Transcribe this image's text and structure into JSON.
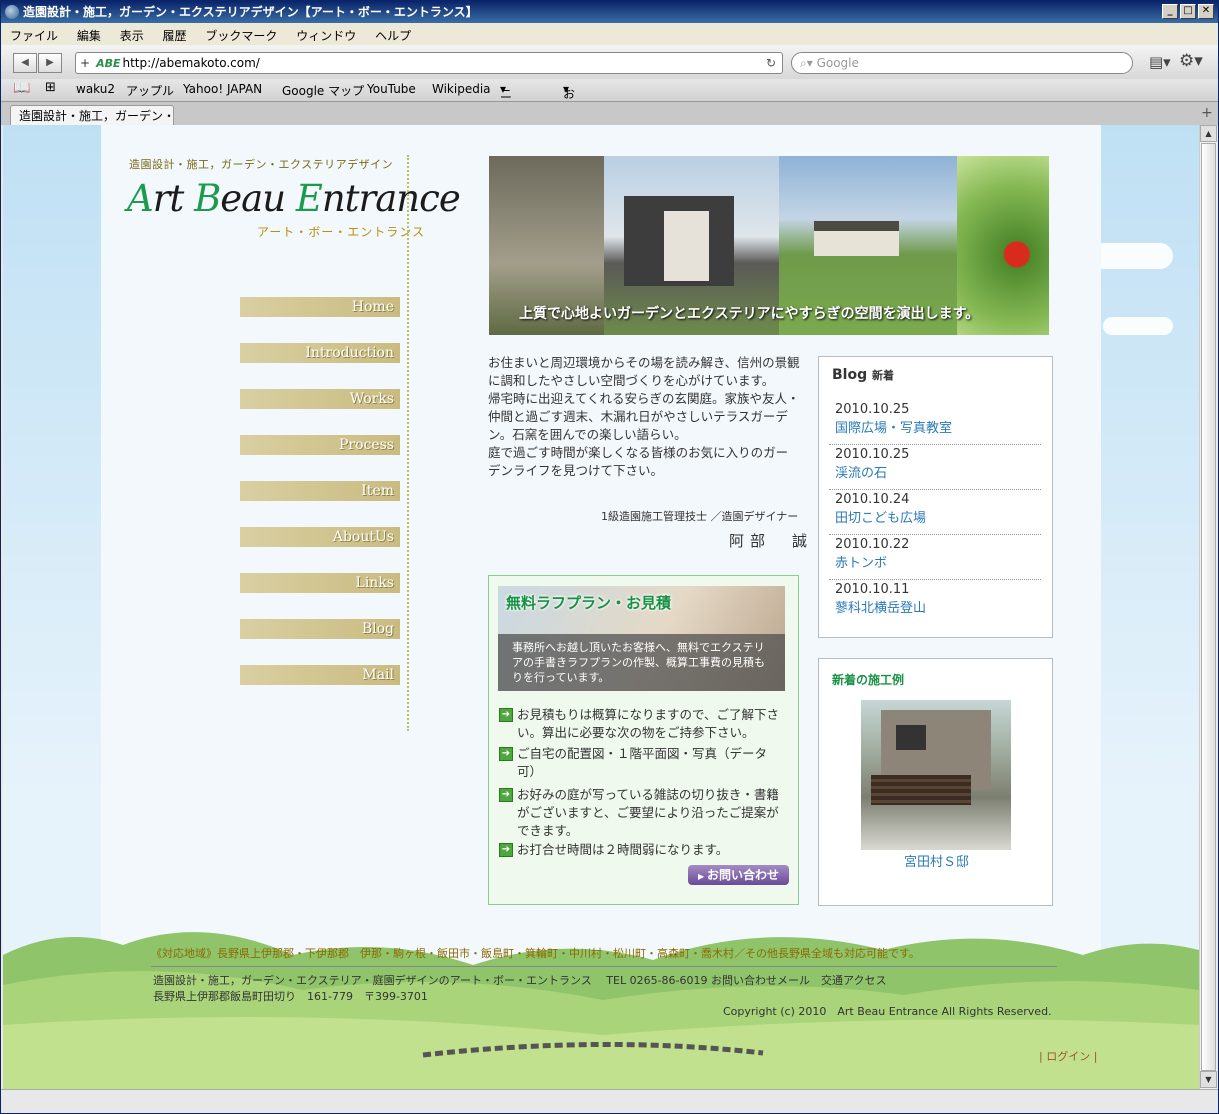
{
  "window": {
    "title": "造園設計・施工，ガーデン・エクステリアデザイン【アート・ボー・エントランス】"
  },
  "menu": [
    "ファイル",
    "編集",
    "表示",
    "履歴",
    "ブックマーク",
    "ウィンドウ",
    "ヘルプ"
  ],
  "toolbar": {
    "url": "http://abemakoto.com/",
    "search_placeholder": "Google",
    "site_icon": "ABE"
  },
  "bookmarks": [
    "waku2",
    "アップル",
    "Yahoo! JAPAN",
    "Google マップ",
    "YouTube",
    "Wikipedia",
    "ニュース",
    "お役立ち"
  ],
  "tab": {
    "label": "造園設計・施工，ガーデン・…"
  },
  "site": {
    "subtitle": "造園設計・施工，ガーデン・エクステリアデザイン",
    "logo": {
      "a": "A",
      "rt": "rt ",
      "b": "B",
      "eau": "eau ",
      "e": "E",
      "ntrance": "ntrance"
    },
    "logo_kana": "アート・ボー・エントランス",
    "nav": [
      "Home",
      "Introduction",
      "Works",
      "Process",
      "Item",
      "AboutUs",
      "Links",
      "Blog",
      "Mail"
    ],
    "hero_caption": "上質で心地よいガーデンとエクステリアにやすらぎの空間を演出します。",
    "intro": [
      "お住まいと周辺環境からその場を読み解き、信州の景観に調和したやさしい空間づくりを心がけています。",
      "帰宅時に出迎えてくれる安らぎの玄関庭。家族や友人・仲間と過ごす週末、木漏れ日がやさしいテラスガーデン。石窯を囲んでの楽しい語らい。",
      "庭で過ごす時間が楽しくなる皆様のお気に入りのガーデンライフを見つけて下さい。"
    ],
    "signature_title": "1級造園施工管理技士 ／造園デザイナー",
    "signature_name": "阿部　誠",
    "estimate": {
      "title": "無料ラフプラン・お見積",
      "band": "事務所へお越し頂いたお客様へ、無料でエクステリアの手書きラフプランの作製、概算工事費の見積もりを行っています。",
      "items": [
        "お見積もりは概算になりますので、ご了解下さい。算出に必要な次の物をご持参下さい。",
        "ご自宅の配置図・１階平面図・写真（データ可）",
        "お好みの庭が写っている雑誌の切り抜き・書籍がございますと、ご要望により沿ったご提案ができます。",
        "お打合せ時間は２時間弱になります。"
      ],
      "button": "お問い合わせ"
    },
    "blog": {
      "title": "Blog",
      "title_small": "新着",
      "entries": [
        {
          "date": "2010.10.25",
          "title": "国際広場・写真教室"
        },
        {
          "date": "2010.10.25",
          "title": "渓流の石"
        },
        {
          "date": "2010.10.24",
          "title": "田切こども広場"
        },
        {
          "date": "2010.10.22",
          "title": "赤トンボ"
        },
        {
          "date": "2010.10.11",
          "title": "蓼科北横岳登山"
        }
      ]
    },
    "works": {
      "title": "新着の施工例",
      "caption": "宮田村Ｓ邸"
    },
    "footer": {
      "area": "《対応地域》長野県上伊那郡・下伊那郡　伊那・駒ヶ根・飯田市・飯島町・箕輪町・中川村・松川町・高森町・喬木村／その他長野県全域も対応可能です。",
      "line1": "造園設計・施工，ガーデン・エクステリア・庭園デザインのアート・ボー・エントランス　 TEL 0265-86-6019 お問い合わせメール　交通アクセス",
      "line2": "長野県上伊那郡飯島町田切り　161-779　〒399-3701",
      "copyright": "Copyright (c) 2010　Art Beau Entrance All Rights Reserved.",
      "login": "| ログイン |"
    }
  }
}
